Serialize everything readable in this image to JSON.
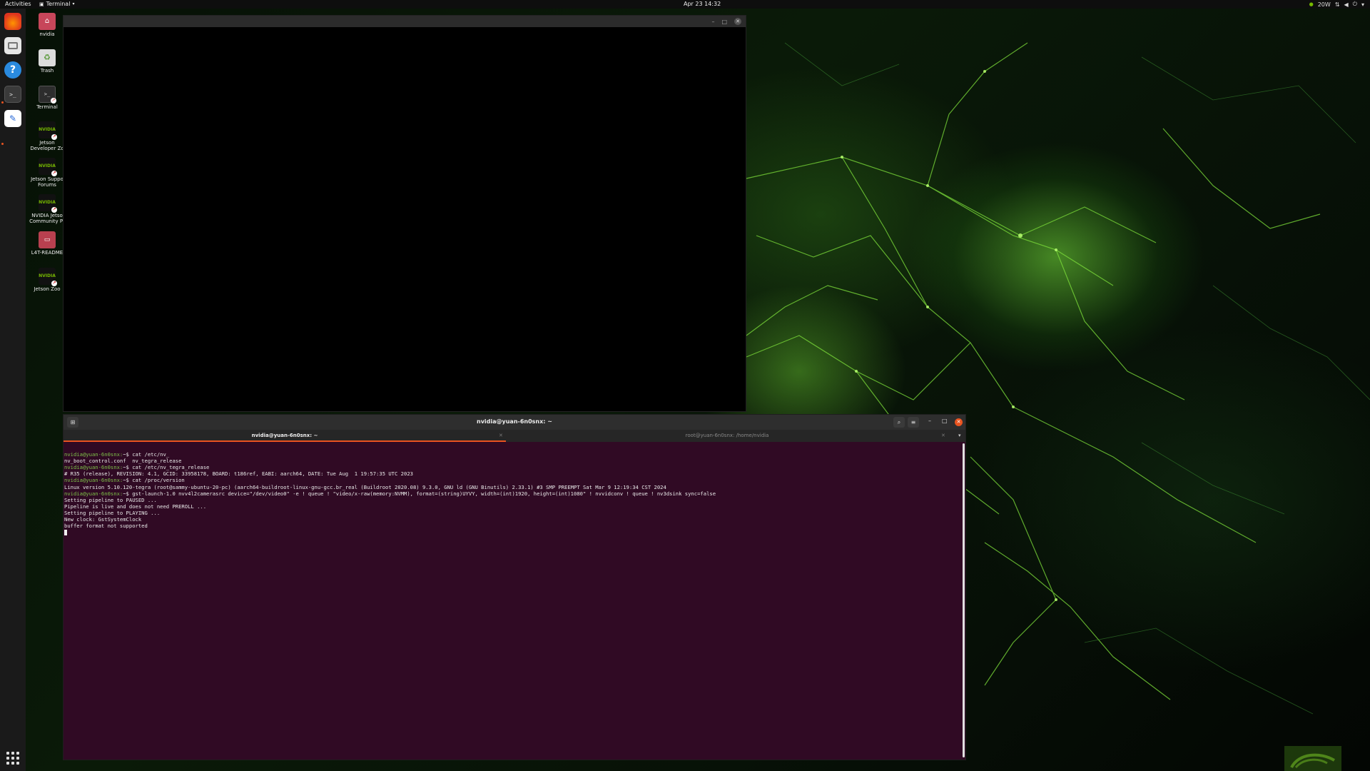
{
  "topbar": {
    "activities": "Activities",
    "app_name": "Terminal",
    "clock": "Apr 23  14:32",
    "power_mode": "20W"
  },
  "dock": {
    "items": [
      "firefox-icon",
      "files-icon",
      "help-icon",
      "terminal-icon",
      "text-editor-icon"
    ],
    "show_apps_icon": "grid-icon"
  },
  "desktop": {
    "icons": [
      {
        "label": "nvidia",
        "icon": "home-folder-icon"
      },
      {
        "label": "Trash",
        "icon": "trash-icon"
      },
      {
        "label": "Terminal",
        "icon": "terminal-icon"
      },
      {
        "label": "Jetson Developer Zo",
        "icon": "nvidia-icon"
      },
      {
        "label": "Jetson Suppo Forums",
        "icon": "nvidia-icon"
      },
      {
        "label": "NVIDIA Jetso Community Pr",
        "icon": "nvidia-icon"
      },
      {
        "label": "L4T-README",
        "icon": "drive-icon"
      },
      {
        "label": "Jetson Zoo",
        "icon": "nvidia-icon"
      }
    ]
  },
  "terminal": {
    "title": "nvidia@yuan-6n0snx: ~",
    "tabs": [
      {
        "label": "nvidia@yuan-6n0snx: ~",
        "active": true
      },
      {
        "label": "root@yuan-6n0snx: /home/nvidia",
        "active": false
      }
    ],
    "lines": [
      {
        "prompt": "nvidia@yuan-6n0snx:",
        "cmd": "~$ cat /etc/nv_"
      },
      {
        "prompt": "",
        "cmd": "nv_boot_control.conf  nv_tegra_release"
      },
      {
        "prompt": "nvidia@yuan-6n0snx:",
        "cmd": "~$ cat /etc/nv_tegra_release"
      },
      {
        "prompt": "",
        "cmd": "# R35 (release), REVISION: 4.1, GCID: 33958178, BOARD: t186ref, EABI: aarch64, DATE: Tue Aug  1 19:57:35 UTC 2023"
      },
      {
        "prompt": "nvidia@yuan-6n0snx:",
        "cmd": "~$ cat /proc/version"
      },
      {
        "prompt": "",
        "cmd": "Linux version 5.10.120-tegra (root@sammy-ubuntu-20-pc) (aarch64-buildroot-linux-gnu-gcc.br_real (Buildroot 2020.08) 9.3.0, GNU ld (GNU Binutils) 2.33.1) #3 SMP PREEMPT Sat Mar 9 12:19:34 CST 2024"
      },
      {
        "prompt": "nvidia@yuan-6n0snx:",
        "cmd": "~$ gst-launch-1.0 nvv4l2camerasrc device=\"/dev/video0\" -e ! queue ! \"video/x-raw(memory:NVMM), format=(string)UYVY, width=(int)1920, height=(int)1080\" ! nvvidconv ! queue ! nv3dsink sync=false"
      },
      {
        "prompt": "",
        "cmd": "Setting pipeline to PAUSED ..."
      },
      {
        "prompt": "",
        "cmd": "Pipeline is live and does not need PREROLL ..."
      },
      {
        "prompt": "",
        "cmd": "Setting pipeline to PLAYING ..."
      },
      {
        "prompt": "",
        "cmd": "New clock: GstSystemClock"
      },
      {
        "prompt": "",
        "cmd": "buffer format not supported"
      }
    ]
  },
  "colors": {
    "terminal_bg": "#300a24",
    "prompt": "#7ec34a",
    "accent": "#e95420",
    "nvidia_green": "#76b900"
  }
}
